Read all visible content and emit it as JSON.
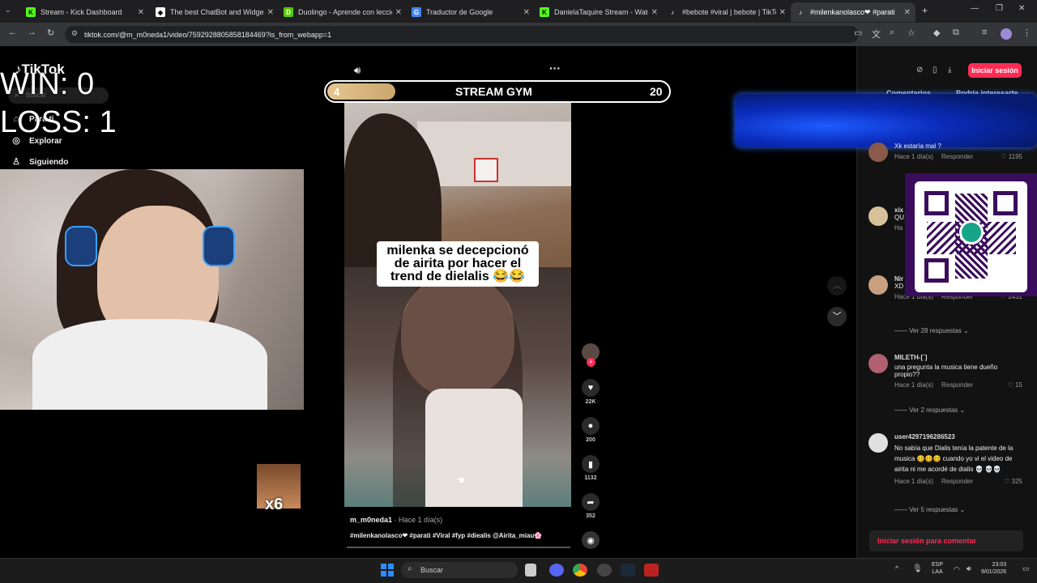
{
  "browser": {
    "tabs": [
      {
        "title": "Stream - Kick Dashboard",
        "icon": "kick-icon"
      },
      {
        "title": "The best ChatBot and Widgets",
        "icon": "streamelements-icon"
      },
      {
        "title": "Duolingo - Aprende con leccio",
        "icon": "duolingo-icon"
      },
      {
        "title": "Traductor de Google",
        "icon": "google-translate-icon"
      },
      {
        "title": "DanielaTaquire Stream - Watch",
        "icon": "kick-icon"
      },
      {
        "title": "#bebote #viral | bebote | TikTok",
        "icon": "tiktok-icon"
      },
      {
        "title": "#milenkanolasco❤ #parati",
        "icon": "tiktok-icon"
      }
    ],
    "url": "tiktok.com/@m_m0neda1/video/7592928805858184469?is_from_webapp=1"
  },
  "overlay": {
    "win_label": "WIN: 0",
    "loss_label": "LOSS: 1",
    "gym_left": "4",
    "gym_title": "STREAM GYM",
    "gym_right": "20",
    "gym_progress": 0.2,
    "emote_badge": "x6"
  },
  "tiktok": {
    "logo": "TikTok",
    "search_placeholder": "Buscar",
    "nav": [
      {
        "label": "Para ti",
        "icon": "home-icon"
      },
      {
        "label": "Explorar",
        "icon": "compass-icon"
      },
      {
        "label": "Siguiendo",
        "icon": "user-icon"
      }
    ],
    "login_button": "Iniciar sesión",
    "panel_tabs": [
      "Comentarios",
      "Podría interesarte"
    ],
    "video_caption": "milenka se decepcionó de airita por hacer el trend de dielalis 😂😂",
    "author": "m_m0neda1",
    "posted": "· Hace 1 día(s)",
    "hashtags": "#milenkanolasco❤ #parati #Viral #fyp #diealis @Airita_miau🌸",
    "actions": {
      "likes": "22K",
      "comments": "200",
      "saves": "1132",
      "shares": "352"
    },
    "comments": [
      {
        "user": "",
        "text": "Xk estaría mal ?",
        "time": "Hace 1 día(s)",
        "reply": "Responder",
        "likes": "1195",
        "avatar_color": "#8b5a4a"
      },
      {
        "user": "xix",
        "text": "QU",
        "time": "Ha",
        "reply": "",
        "likes": "",
        "avatar_color": "#d8c09a"
      },
      {
        "user": "Nir",
        "text": "XD",
        "time": "Hace 1 día(s)",
        "reply": "Responder",
        "likes": "2431",
        "avatar_color": "#c8a080"
      },
      {
        "user": "MILETH-[´]",
        "text": "una pregunta la musica tiene dueño propio??",
        "time": "Hace 1 día(s)",
        "reply": "Responder",
        "likes": "15",
        "avatar_color": "#b06070"
      },
      {
        "user": "user4297196286523",
        "text": "No sabía que Dialis tenía la patente de la musica 🥴🥴🥴 cuando yo vi el video de airita ni me acordé de dialis 💀 💀💀",
        "time": "Hace 1 día(s)",
        "reply": "Responder",
        "likes": "325",
        "avatar_color": "#e0e0e0"
      }
    ],
    "replies": [
      "Ver 28 respuestas",
      "Ver 2 respuestas",
      "Ver 5 respuestas"
    ],
    "comment_login": "Iniciar sesión para comentar"
  },
  "taskbar": {
    "search": "Buscar",
    "lang": "ESP",
    "lang2": "LAA",
    "time": "23:03",
    "date": "9/01/2026"
  },
  "colors": {
    "tiktok_red": "#fe2c55",
    "qr_purple": "#3a0d5c",
    "gym_gold": "#e6c690"
  }
}
